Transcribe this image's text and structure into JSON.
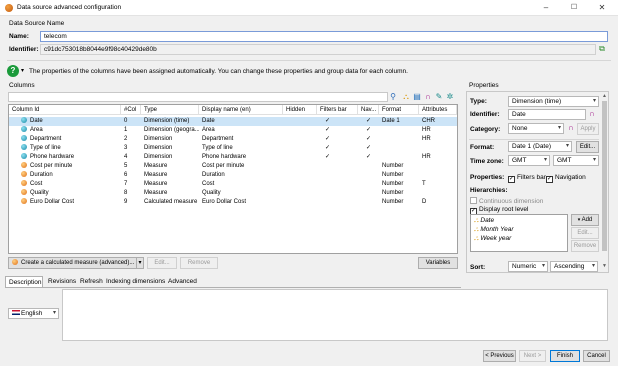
{
  "window": {
    "title": "Data source advanced configuration",
    "minimize": "–",
    "maximize": "☐",
    "close": "✕"
  },
  "datasource": {
    "section_title": "Data Source Name",
    "name_label": "Name:",
    "name_value": "telecom",
    "identifier_label": "Identifier:",
    "identifier_value": "c91dc753018b8044e9f98c40429de80b"
  },
  "info_text": "The properties of the columns have been assigned automatically. You can change these properties and group data for each column.",
  "columns": {
    "title": "Columns",
    "headers": [
      "Column Id",
      "#Col",
      "Type",
      "Display name (en)",
      "Hidden",
      "Filters bar",
      "Nav...",
      "Format",
      "Attributes"
    ],
    "rows": [
      {
        "id": "Date",
        "col": "0",
        "type": "Dimension (time)",
        "display": "Date",
        "hidden": "",
        "filters": "✓",
        "nav": "✓",
        "format": "Date 1",
        "attr": "CHR",
        "kind": "dim",
        "selected": true
      },
      {
        "id": "Area",
        "col": "1",
        "type": "Dimension (geogra...",
        "display": "Area",
        "hidden": "",
        "filters": "✓",
        "nav": "✓",
        "format": "",
        "attr": "HR",
        "kind": "dim",
        "selected": false
      },
      {
        "id": "Department",
        "col": "2",
        "type": "Dimension",
        "display": "Department",
        "hidden": "",
        "filters": "✓",
        "nav": "✓",
        "format": "",
        "attr": "HR",
        "kind": "dim",
        "selected": false
      },
      {
        "id": "Type of line",
        "col": "3",
        "type": "Dimension",
        "display": "Type of line",
        "hidden": "",
        "filters": "✓",
        "nav": "✓",
        "format": "",
        "attr": "",
        "kind": "dim",
        "selected": false
      },
      {
        "id": "Phone hardware",
        "col": "4",
        "type": "Dimension",
        "display": "Phone hardware",
        "hidden": "",
        "filters": "✓",
        "nav": "✓",
        "format": "",
        "attr": "HR",
        "kind": "dim",
        "selected": false
      },
      {
        "id": "Cost per minute",
        "col": "5",
        "type": "Measure",
        "display": "Cost per minute",
        "hidden": "",
        "filters": "",
        "nav": "",
        "format": "Number",
        "attr": "",
        "kind": "mea",
        "selected": false
      },
      {
        "id": "Duration",
        "col": "6",
        "type": "Measure",
        "display": "Duration",
        "hidden": "",
        "filters": "",
        "nav": "",
        "format": "Number",
        "attr": "",
        "kind": "mea",
        "selected": false
      },
      {
        "id": "Cost",
        "col": "7",
        "type": "Measure",
        "display": "Cost",
        "hidden": "",
        "filters": "",
        "nav": "",
        "format": "Number",
        "attr": "T",
        "kind": "mea",
        "selected": false
      },
      {
        "id": "Quality",
        "col": "8",
        "type": "Measure",
        "display": "Quality",
        "hidden": "",
        "filters": "",
        "nav": "",
        "format": "Number",
        "attr": "",
        "kind": "mea",
        "selected": false
      },
      {
        "id": "Euro Dollar Cost",
        "col": "9",
        "type": "Calculated measure",
        "display": "Euro Dollar Cost",
        "hidden": "",
        "filters": "",
        "nav": "",
        "format": "Number",
        "attr": "D",
        "kind": "mea",
        "selected": false
      }
    ],
    "create_button": "Create a calculated measure (advanced)...",
    "edit_button": "Edit...",
    "remove_button": "Remove",
    "variables_button": "Variables"
  },
  "tabs": [
    "Description",
    "Revisions",
    "Refresh",
    "Indexing dimensions",
    "Advanced"
  ],
  "language": "English",
  "properties": {
    "title": "Properties",
    "type_label": "Type:",
    "type_value": "Dimension (time)",
    "identifier_label": "Identifier:",
    "identifier_value": "Date",
    "category_label": "Category:",
    "category_value": "None",
    "apply_button": "Apply",
    "format_label": "Format:",
    "format_value": "Date 1 (Date)",
    "format_edit": "Edit...",
    "timezone_label": "Time zone:",
    "tz1": "GMT",
    "tz2": "GMT",
    "props_label": "Properties:",
    "filters_bar": "Filters bar",
    "navigation": "Navigation",
    "hierarchies_label": "Hierarchies:",
    "continuous": "Continuous dimension",
    "display_root": "Display root level",
    "hierarchy_items": [
      "Date",
      "Month Year",
      "Week year"
    ],
    "add_button": "Add",
    "edit_button": "Edit...",
    "remove_button": "Remove",
    "sort_label": "Sort:",
    "sort1": "Numeric",
    "sort2": "Ascending"
  },
  "footer": {
    "previous": "< Previous",
    "next": "Next >",
    "finish": "Finish",
    "cancel": "Cancel"
  }
}
